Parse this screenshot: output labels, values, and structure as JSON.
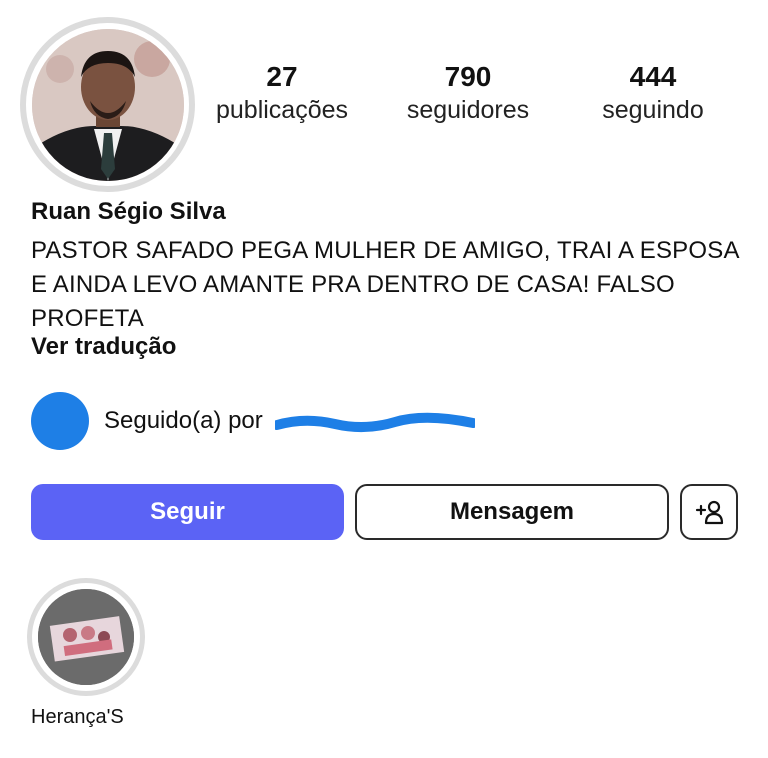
{
  "profile": {
    "name": "Ruan Ségio Silva",
    "bio": "PASTOR SAFADO PEGA MULHER DE AMIGO, TRAI A ESPOSA E AINDA LEVO AMANTE PRA DENTRO DE CASA! FALSO PROFETA",
    "translate_label": "Ver tradução"
  },
  "stats": {
    "posts": {
      "value": "27",
      "label": "publicações"
    },
    "followers": {
      "value": "790",
      "label": "seguidores"
    },
    "following": {
      "value": "444",
      "label": "seguindo"
    }
  },
  "followed_by": {
    "text": "Seguido(a) por"
  },
  "actions": {
    "follow_label": "Seguir",
    "message_label": "Mensagem",
    "suggest_icon": "add-person-icon"
  },
  "highlights": [
    {
      "label": "Herança'S"
    }
  ],
  "colors": {
    "follow_button": "#5b63f5",
    "ring": "#dcdcdc",
    "redaction": "#1e7fe6"
  }
}
